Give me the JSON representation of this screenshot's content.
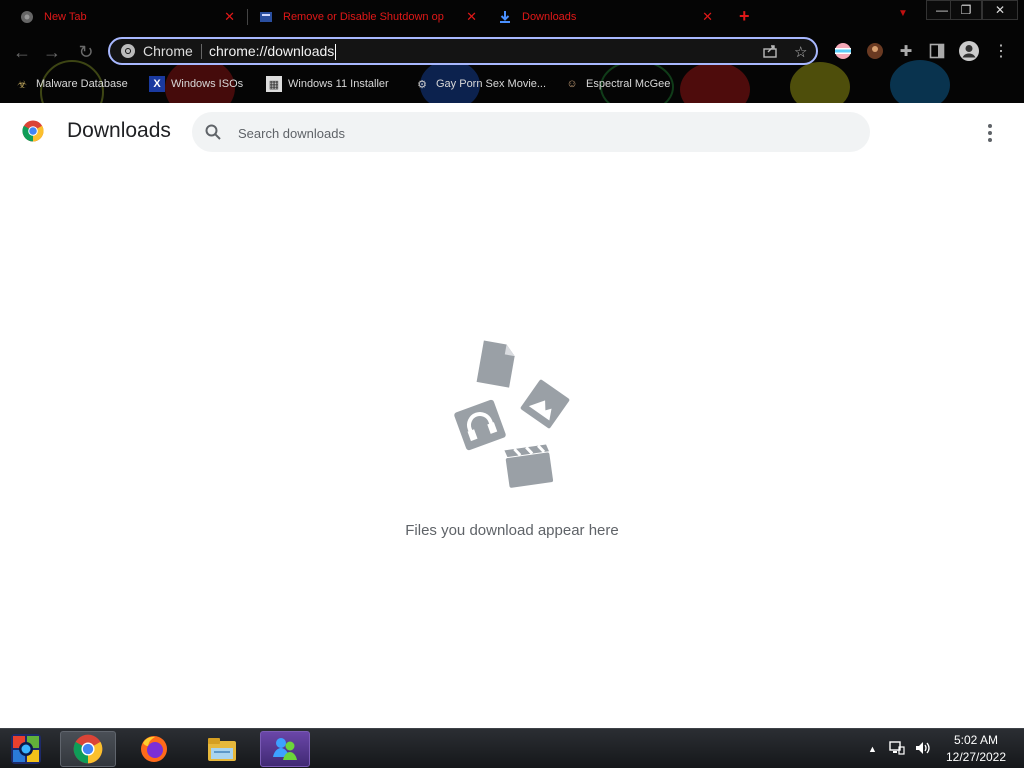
{
  "tabs": [
    {
      "title": "New Tab"
    },
    {
      "title": "Remove or Disable Shutdown op"
    },
    {
      "title": "Downloads"
    }
  ],
  "tab_close_glyph": "✕",
  "new_tab_glyph": "+",
  "window_controls": {
    "minimize": "—",
    "restore": "❐",
    "close": "✕"
  },
  "omnibox": {
    "chip": "Chrome",
    "url": "chrome://downloads"
  },
  "bookmarks": [
    {
      "label": "Malware Database",
      "icon": "malware-icon"
    },
    {
      "label": "Windows ISOs",
      "icon": "x-logo-icon"
    },
    {
      "label": "Windows 11 Installer",
      "icon": "installer-icon"
    },
    {
      "label": "Gay Porn Sex Movie...",
      "icon": "site-icon"
    },
    {
      "label": "Espectral McGee",
      "icon": "site-icon"
    }
  ],
  "page": {
    "title": "Downloads",
    "search_placeholder": "Search downloads",
    "empty_message": "Files you download appear here"
  },
  "taskbar": {
    "apps": [
      "start-orb",
      "chrome",
      "firefox",
      "file-explorer",
      "messenger"
    ],
    "clock_time": "5:02 AM",
    "clock_date": "12/27/2022"
  },
  "colors": {
    "tab_text": "#e01818",
    "omnibox_focus": "#a8b8ff",
    "page_title": "#202124",
    "muted": "#5f6368"
  }
}
